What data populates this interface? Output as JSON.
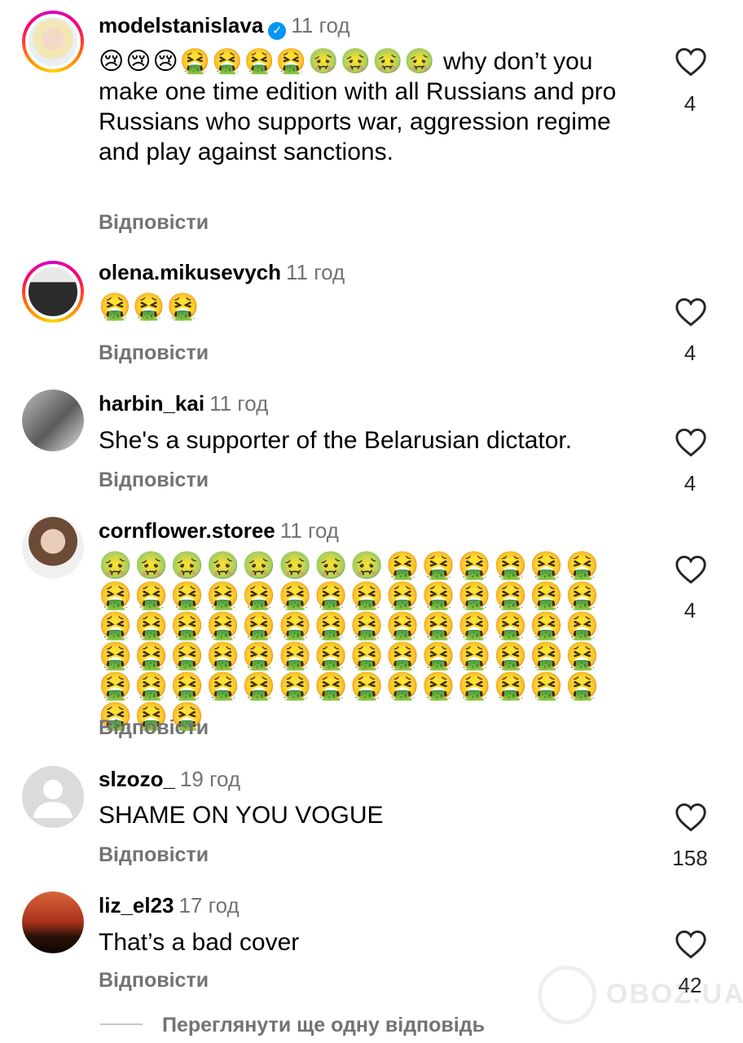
{
  "comments": [
    {
      "username": "modelstanislava",
      "verified": true,
      "time": "11 год",
      "text_emoji": "😢😢😢🤮🤮🤮🤮🤢🤢🤢🤢",
      "text": "why don’t you make one time edition with all Russians and pro Russians who supports war, aggression regime and play against sanctions.",
      "reply_label": "Відповісти",
      "likes": "4",
      "avatar": "woman-blonde-avatar"
    },
    {
      "username": "olena.mikusevych",
      "time": "11 год",
      "text": "🤮🤮🤮",
      "reply_label": "Відповісти",
      "likes": "4",
      "avatar": "woman-dark-avatar"
    },
    {
      "username": "harbin_kai",
      "time": "11 год",
      "text": "She's a supporter of the Belarusian dictator.",
      "reply_label": "Відповісти",
      "likes": "4",
      "avatar": "person-reclining-avatar"
    },
    {
      "username": "cornflower.storee",
      "time": "11 год",
      "text": "🤢🤢🤢🤢🤢🤢🤢🤢🤮🤮🤮🤮🤮🤮🤮🤮🤮🤮🤮🤮🤮🤮🤮🤮🤮🤮🤮🤮🤮🤮🤮🤮🤮🤮🤮🤮🤮🤮🤮🤮🤮🤮🤮🤮🤮🤮🤮🤮🤮🤮🤮🤮🤮🤮🤮🤮🤮🤮🤮🤮🤮🤮🤮🤮🤮🤮🤮🤮🤮🤮🤮🤮🤮",
      "reply_label": "Відповісти",
      "likes": "4",
      "avatar": "woman-portrait-avatar"
    },
    {
      "username": "slzozo_",
      "time": "19 год",
      "text": "SHAME ON YOU VOGUE",
      "reply_label": "Відповісти",
      "likes": "158",
      "avatar": "default-user-avatar"
    },
    {
      "username": "liz_el23",
      "time": "17 год",
      "text": "That’s a bad cover",
      "reply_label": "Відповісти",
      "likes": "42",
      "avatar": "sunset-palm-avatar"
    }
  ],
  "view_more": "Переглянути ще одну відповідь",
  "watermark": "OBOZ.UA",
  "colors": {
    "secondary_text": "#737373",
    "verified_blue": "#0095f6"
  },
  "icons": {
    "like": "heart-outline-icon",
    "verified": "verified-badge-icon"
  }
}
